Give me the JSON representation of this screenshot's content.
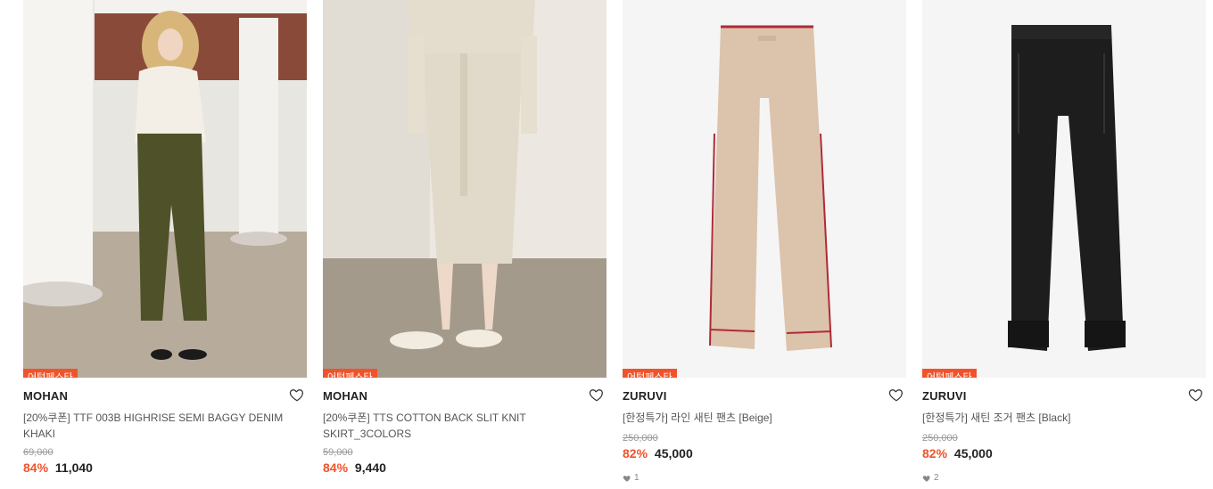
{
  "colors": {
    "accent": "#f0532b"
  },
  "products": [
    {
      "badge": "어텀페스타",
      "brand": "MOHAN",
      "name_lines": [
        "[20%쿠폰] TTF 003B HIGHRISE SEMI BAGGY DENIM",
        "KHAKI"
      ],
      "original_price": "69,000",
      "discount_rate": "84%",
      "sale_price": "11,040",
      "likes": ""
    },
    {
      "badge": "어텀페스타",
      "brand": "MOHAN",
      "name_lines": [
        "[20%쿠폰] TTS COTTON BACK SLIT KNIT",
        "SKIRT_3COLORS"
      ],
      "original_price": "59,000",
      "discount_rate": "84%",
      "sale_price": "9,440",
      "likes": ""
    },
    {
      "badge": "어텀페스타",
      "brand": "ZURUVI",
      "name_lines": [
        "[한정특가] 라인 새틴 팬츠 [Beige]",
        ""
      ],
      "original_price": "250,000",
      "discount_rate": "82%",
      "sale_price": "45,000",
      "likes": "1"
    },
    {
      "badge": "어텀페스타",
      "brand": "ZURUVI",
      "name_lines": [
        "[한정특가] 새틴 조거 팬츠 [Black]",
        ""
      ],
      "original_price": "250,000",
      "discount_rate": "82%",
      "sale_price": "45,000",
      "likes": "2"
    }
  ],
  "icons": {
    "wishlist": "heart-outline-icon",
    "likes": "heart-filled-icon"
  }
}
